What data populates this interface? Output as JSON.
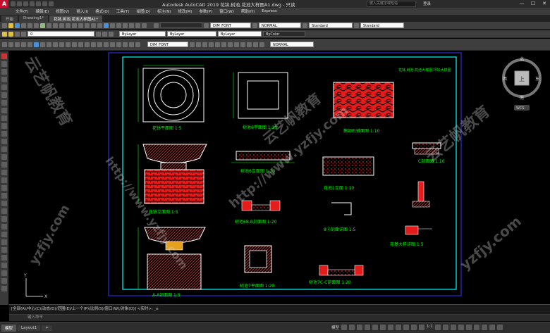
{
  "app": {
    "title": "Autodesk AutoCAD 2019    花钵,树池,花池大样图A1.dwg - 只读",
    "search_placeholder": "键入关键字或短语",
    "login_label": "登录"
  },
  "menu": [
    "文件(F)",
    "编辑(E)",
    "视图(V)",
    "插入(I)",
    "格式(O)",
    "工具(T)",
    "绘图(D)",
    "标注(N)",
    "修改(M)",
    "参数(P)",
    "窗口(W)",
    "帮助(H)",
    "Express"
  ],
  "tabs": [
    "开始",
    "Drawing1*",
    "花钵,树池,花池大样图A1*"
  ],
  "toolbar": {
    "layer_value": "0",
    "bylayer_color": "ByLayer",
    "bylayer_linetype": "ByLayer",
    "bylayer_lineweight": "ByLayer",
    "bycolor": "ByColor",
    "dim_style": "DIM_FONT",
    "visual_style": "NORMAL",
    "table_style": "Standard",
    "multileader_style": "Standard",
    "plot_style": "NORMAL"
  },
  "viewcube": {
    "north": "北",
    "south": "南",
    "east": "东",
    "west": "西",
    "top": "上",
    "wcs": "WCS"
  },
  "drawing": {
    "title_note": "花钵,树池,花池大样图,坪坛大样图",
    "labels": {
      "l1": "花钵平面图  1:5",
      "l2": "树池6平面图  1:20",
      "l3": "鹅卵石铺面图  1:10",
      "l4": "树池6立面图  1:20",
      "l5": "C剖面图  1:10",
      "l6": "花钵立面图  1:5",
      "l7": "花池1立面  1:10",
      "l8": "树池6B-B剖面图  1:20",
      "l9": "8ⓓ剖面详图  1:5",
      "l10": "花基大样详图  1:5",
      "l11": "A-A剖面图  1:5",
      "l12": "树池7平面图  1:20",
      "l13": "树池7C-C剖面图  1:20"
    }
  },
  "command": {
    "history": "[全部(A)/中心(C)/动态(D)/范围(E)/上一个(P)/比例(S)/窗口(W)/对象(O)] <实时>: _e",
    "prompt": "键入命令"
  },
  "layouts": [
    "模型",
    "Layout1",
    "+"
  ],
  "status": {
    "model_label": "模型",
    "scale": "1:1"
  },
  "watermarks": {
    "brand": "云艺帆教育",
    "url1": "http://www.yzfjy.com",
    "url2": "yzfjy.com",
    "url3": "http://www.yzfjy.com"
  },
  "colors": {
    "bg": "#000000",
    "frame": "#00ffff",
    "outer_frame": "#3333ff",
    "hatch": "#e51c1c",
    "line": "#ffffff",
    "text": "#00ff00",
    "dim": "#00ff00"
  }
}
